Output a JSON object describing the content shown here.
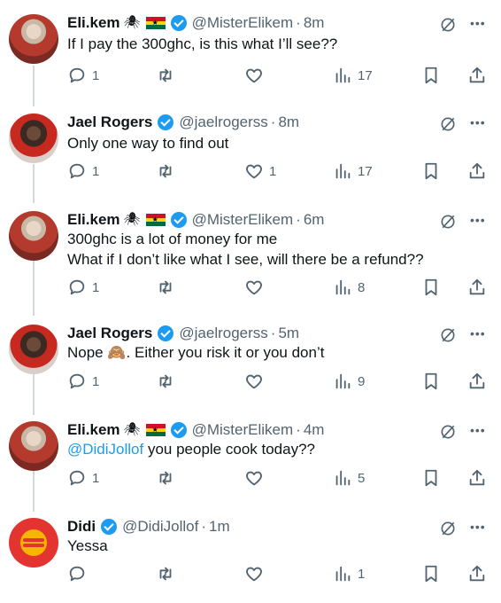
{
  "tweets": [
    {
      "name": "Eli.kem",
      "handle": "@MisterElikem",
      "time": "8m",
      "lines": [
        "If I pay the 300ghc, is this what I’ll see??"
      ],
      "replies": "1",
      "likes": "",
      "views": "17",
      "avatar": "avatar-elikem",
      "verified": true,
      "emojis": [
        "spider-icon",
        "ghana-flag-icon"
      ]
    },
    {
      "name": "Jael Rogers",
      "handle": "@jaelrogerss",
      "time": "8m",
      "lines": [
        "Only one way to find out"
      ],
      "replies": "1",
      "likes": "1",
      "views": "17",
      "avatar": "avatar-jael",
      "verified": true,
      "emojis": []
    },
    {
      "name": "Eli.kem",
      "handle": "@MisterElikem",
      "time": "6m",
      "lines": [
        "300ghc is a lot of money for me",
        "What if I don’t like what I see, will there be a refund??"
      ],
      "replies": "1",
      "likes": "",
      "views": "8",
      "avatar": "avatar-elikem",
      "verified": true,
      "emojis": [
        "spider-icon",
        "ghana-flag-icon"
      ]
    },
    {
      "name": "Jael Rogers",
      "handle": "@jaelrogerss",
      "time": "5m",
      "lines": [
        "Nope 🙈. Either you risk it or you don’t"
      ],
      "replies": "1",
      "likes": "",
      "views": "9",
      "avatar": "avatar-jael",
      "verified": true,
      "emojis": []
    },
    {
      "name": "Eli.kem",
      "handle": "@MisterElikem",
      "time": "4m",
      "mention": "@DidiJollof",
      "lines": [
        " you people cook today??"
      ],
      "replies": "1",
      "likes": "",
      "views": "5",
      "avatar": "avatar-elikem",
      "verified": true,
      "emojis": [
        "spider-icon",
        "ghana-flag-icon"
      ]
    },
    {
      "name": "Didi",
      "handle": "@DidiJollof",
      "time": "1m",
      "lines": [
        "Yessa"
      ],
      "replies": "",
      "likes": "",
      "views": "1",
      "avatar": "avatar-didi",
      "verified": true,
      "emojis": []
    }
  ],
  "colors": {
    "accent": "#1d9bf0",
    "muted": "#536471",
    "text": "#0f1419",
    "thread_line": "#cfd9de"
  }
}
